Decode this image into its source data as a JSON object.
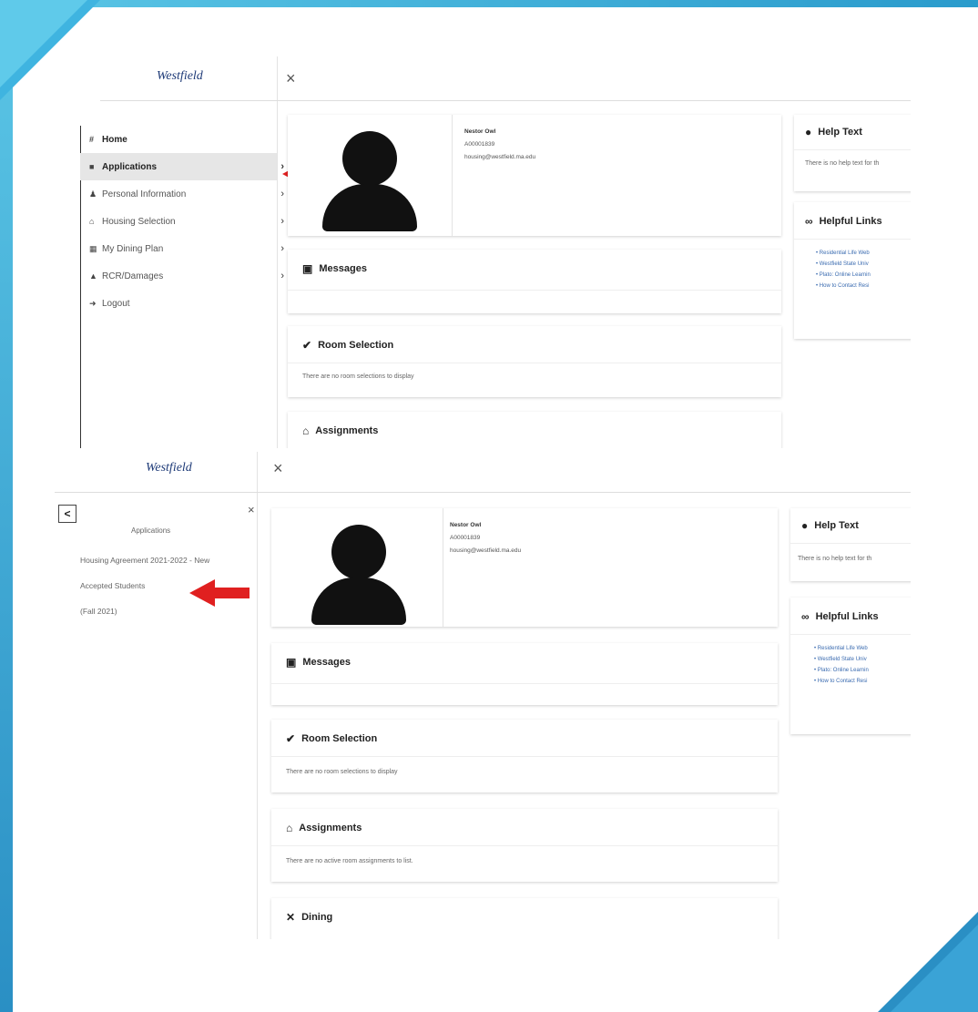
{
  "brand": {
    "logo_text": "Westfield"
  },
  "close_glyph": "×",
  "nav": {
    "items": [
      {
        "icon": "home-icon",
        "glyph": "#",
        "label": "Home",
        "has_chevron": false
      },
      {
        "icon": "application-icon",
        "glyph": "■",
        "label": "Applications",
        "has_chevron": true
      },
      {
        "icon": "person-icon",
        "glyph": "♟",
        "label": "Personal Information",
        "has_chevron": true
      },
      {
        "icon": "bed-icon",
        "glyph": "⌂",
        "label": "Housing Selection",
        "has_chevron": true
      },
      {
        "icon": "dining-icon",
        "glyph": "▦",
        "label": "My Dining Plan",
        "has_chevron": true
      },
      {
        "icon": "warning-icon",
        "glyph": "▲",
        "label": "RCR/Damages",
        "has_chevron": true
      },
      {
        "icon": "logout-icon",
        "glyph": "➜",
        "label": "Logout",
        "has_chevron": false
      }
    ],
    "chevron_glyph": "›"
  },
  "profile": {
    "name": "Nestor Owl",
    "id": "A00001839",
    "email": "housing@westfield.ma.edu"
  },
  "cards": {
    "messages": {
      "title": "Messages"
    },
    "room_selection": {
      "title": "Room Selection",
      "body": "There are no room selections to display"
    },
    "assignments": {
      "title": "Assignments",
      "body": "There are no active room assignments to list."
    },
    "dining": {
      "title": "Dining"
    }
  },
  "help": {
    "title": "Help Text",
    "body": "There is no help text for th"
  },
  "helpful_links": {
    "title": "Helpful Links",
    "links": [
      "Residential Life Web",
      "Westfield State Univ",
      "Plato: Online Learnin",
      "How to Contact Resi"
    ]
  },
  "submenu": {
    "title": "Applications",
    "back_glyph": "<",
    "items": [
      "Housing Agreement 2021-2022 - New",
      "Accepted Students",
      "(Fall 2021)"
    ]
  },
  "colors": {
    "accent": "#e02020",
    "frame": "#2a9bcc"
  }
}
